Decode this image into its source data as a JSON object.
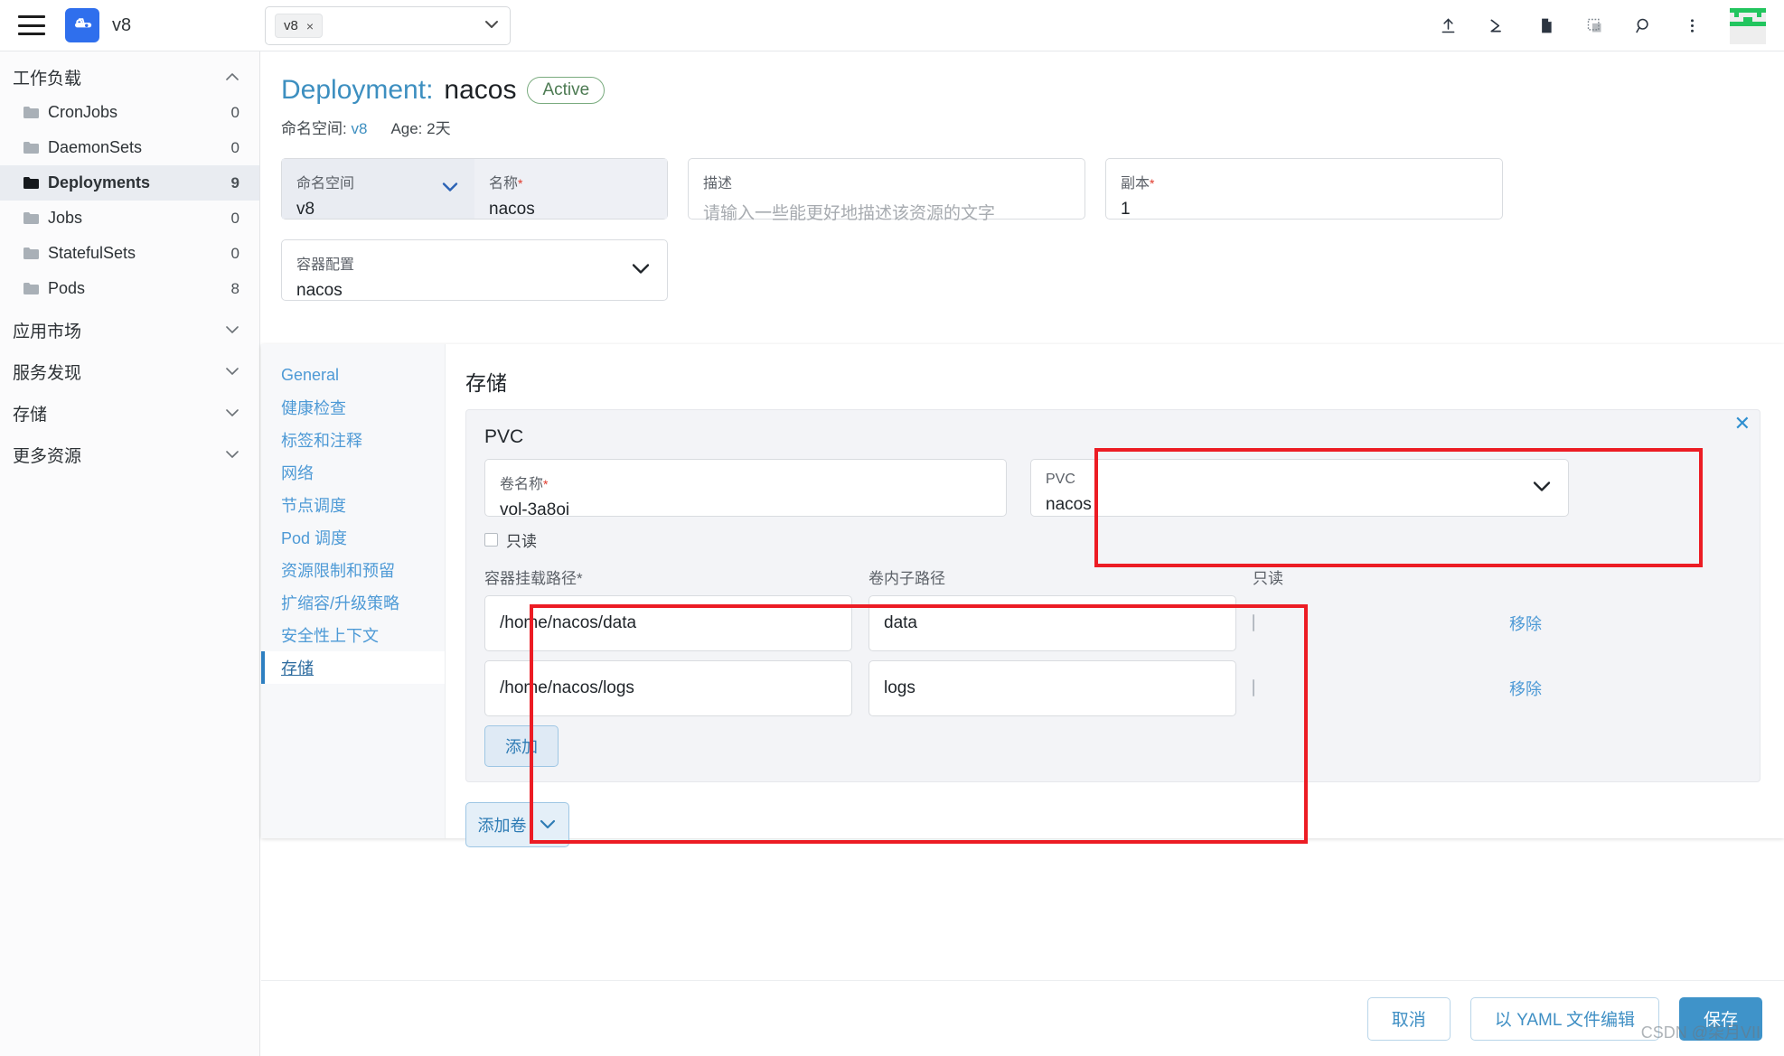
{
  "topbar": {
    "brand": "v8",
    "menu_icon": "hamburger-icon",
    "logo_icon": "kubernetes-dashboard-logo",
    "namespace_chip": "v8",
    "chip_close": "×",
    "caret": "⌄",
    "actions": [
      {
        "name": "upload-icon",
        "title": "upload"
      },
      {
        "name": "terminal-icon",
        "title": "terminal"
      },
      {
        "name": "file-icon",
        "title": "file"
      },
      {
        "name": "copy-icon",
        "title": "copy"
      },
      {
        "name": "search-icon",
        "title": "search"
      },
      {
        "name": "more-vertical-icon",
        "title": "more"
      }
    ]
  },
  "sidebar": {
    "groups": [
      {
        "label": "工作负载",
        "expanded": true,
        "chevron": "⌃",
        "items": [
          {
            "label": "CronJobs",
            "count": "0",
            "active": false
          },
          {
            "label": "DaemonSets",
            "count": "0",
            "active": false
          },
          {
            "label": "Deployments",
            "count": "9",
            "active": true
          },
          {
            "label": "Jobs",
            "count": "0",
            "active": false
          },
          {
            "label": "StatefulSets",
            "count": "0",
            "active": false
          },
          {
            "label": "Pods",
            "count": "8",
            "active": false
          }
        ]
      },
      {
        "label": "应用市场",
        "expanded": false,
        "chevron": "⌄",
        "items": []
      },
      {
        "label": "服务发现",
        "expanded": false,
        "chevron": "⌄",
        "items": []
      },
      {
        "label": "存储",
        "expanded": false,
        "chevron": "⌄",
        "items": []
      },
      {
        "label": "更多资源",
        "expanded": false,
        "chevron": "⌄",
        "items": []
      }
    ]
  },
  "header": {
    "kind": "Deployment:",
    "name": "nacos",
    "status": "Active",
    "namespace_label": "命名空间:",
    "namespace_value": "v8",
    "age_label": "Age:",
    "age_value": "2天"
  },
  "form": {
    "namespace": {
      "label": "命名空间",
      "value": "v8",
      "caret": "⌄"
    },
    "name": {
      "label": "名称",
      "required": "*",
      "value": "nacos"
    },
    "description": {
      "label": "描述",
      "placeholder": "请输入一些能更好地描述该资源的文字"
    },
    "replicas": {
      "label": "副本",
      "required": "*",
      "value": "1"
    },
    "container": {
      "label": "容器配置",
      "value": "nacos",
      "caret": "⌄"
    }
  },
  "tabs": [
    {
      "label": "General",
      "active": false
    },
    {
      "label": "健康检查",
      "active": false
    },
    {
      "label": "标签和注释",
      "active": false
    },
    {
      "label": "网络",
      "active": false
    },
    {
      "label": "节点调度",
      "active": false
    },
    {
      "label": "Pod 调度",
      "active": false
    },
    {
      "label": "资源限制和预留",
      "active": false
    },
    {
      "label": "扩缩容/升级策略",
      "active": false
    },
    {
      "label": "安全性上下文",
      "active": false
    },
    {
      "label": "存储",
      "active": true
    }
  ],
  "storage": {
    "heading": "存储",
    "volume": {
      "title": "PVC",
      "close": "✕",
      "volume_name": {
        "label": "卷名称",
        "required": "*",
        "value": "vol-3a8oi"
      },
      "pvc": {
        "label": "PVC",
        "value": "nacos",
        "caret": "⌄"
      },
      "readonly_label": "只读"
    },
    "mount_table": {
      "columns": [
        "容器挂载路径*",
        "卷内子路径",
        "只读",
        ""
      ],
      "rows": [
        {
          "mount_path": "/home/nacos/data",
          "sub_path": "data",
          "readonly": false,
          "remove": "移除"
        },
        {
          "mount_path": "/home/nacos/logs",
          "sub_path": "logs",
          "readonly": false,
          "remove": "移除"
        }
      ]
    },
    "add_mount_label": "添加",
    "add_volume_label": "添加卷",
    "add_volume_caret": "⌄"
  },
  "footer": {
    "cancel": "取消",
    "yaml": "以 YAML 文件编辑",
    "save": "保存"
  },
  "watermark": "CSDN @柒月VII",
  "colors": {
    "accent_blue": "#3d8fc0",
    "brand_blue": "#2f6fed",
    "annotation_red": "#ec1c24",
    "active_green": "#4c7a52"
  }
}
